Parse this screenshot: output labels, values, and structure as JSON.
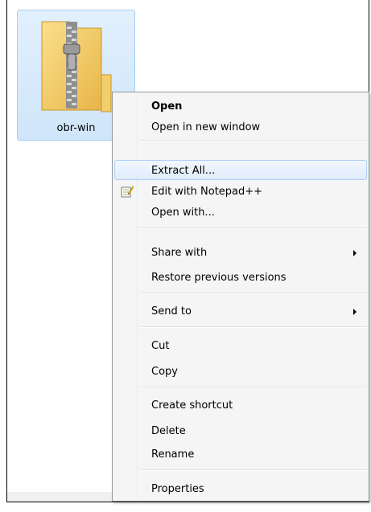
{
  "file": {
    "name": "obr-win",
    "icon": "zip-folder-icon"
  },
  "context_menu": {
    "items": {
      "open": "Open",
      "open_new_window": "Open in new window",
      "extract_all": "Extract All...",
      "edit_notepadpp": "Edit with Notepad++",
      "open_with": "Open with...",
      "share_with": "Share with",
      "restore_previous": "Restore previous versions",
      "send_to": "Send to",
      "cut": "Cut",
      "copy": "Copy",
      "create_shortcut": "Create shortcut",
      "delete": "Delete",
      "rename": "Rename",
      "properties": "Properties"
    },
    "highlighted_item": "Extract All...",
    "icons": {
      "notepadpp": "notepadpp-icon",
      "submenu": "chevron-right-icon"
    }
  },
  "colors": {
    "selection_bg": "#cfe5fa",
    "selection_border": "#a9cfee",
    "menu_bg": "#f5f5f5",
    "menu_hover_border": "#aecff7"
  }
}
